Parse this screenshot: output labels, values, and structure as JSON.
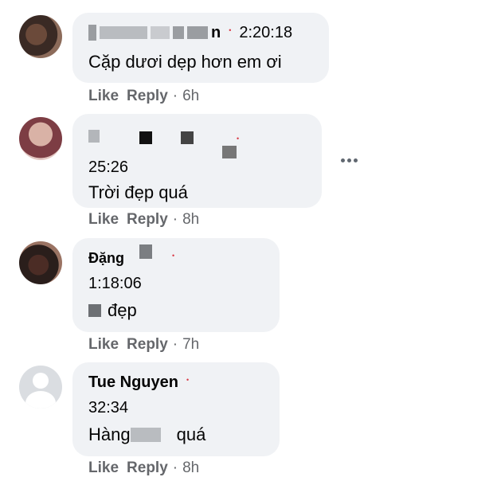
{
  "comments": [
    {
      "name_visible": "n",
      "time": "2:20:18",
      "text": "Cặp dươi dẹp hơn em ơi",
      "actions": {
        "like": "Like",
        "reply": "Reply",
        "age": "6h"
      }
    },
    {
      "name_visible": "",
      "time": "25:26",
      "text": "Trời đẹp quá",
      "actions": {
        "like": "Like",
        "reply": "Reply",
        "age": "8h"
      }
    },
    {
      "name_visible": "Đặng",
      "time": "1:18:06",
      "text": "đẹp",
      "actions": {
        "like": "Like",
        "reply": "Reply",
        "age": "7h"
      }
    },
    {
      "name_visible": "Tue Nguyen",
      "time": "32:34",
      "text_prefix": "Hàng",
      "text_suffix": "quá",
      "actions": {
        "like": "Like",
        "reply": "Reply",
        "age": "8h"
      }
    }
  ],
  "separator": "·",
  "menu_icon": "more-horizontal-icon",
  "badge_dot": "•"
}
